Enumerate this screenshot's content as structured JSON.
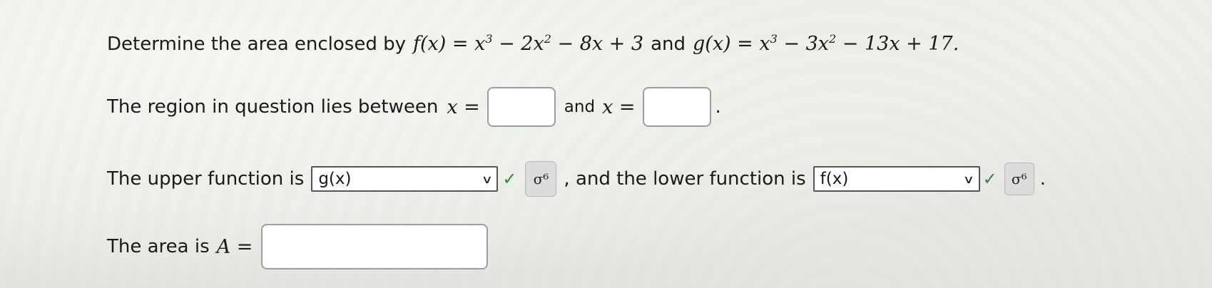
{
  "problem": {
    "prefix": "Determine the area enclosed by",
    "f_def": "f(x) = x",
    "f_exp1": "3",
    "f_mid": " − 2x",
    "f_exp2": "2",
    "f_tail": " − 8x + 3",
    "and_word": "and",
    "g_def": "g(x) = x",
    "g_exp1": "3",
    "g_mid": " − 3x",
    "g_exp2": "2",
    "g_tail": " − 13x + 17."
  },
  "bounds": {
    "text": "The region in question lies between",
    "var_eq_1": "x =",
    "and_word": "and",
    "var_eq_2": "x =",
    "lower_value": "",
    "upper_value": "",
    "end": "."
  },
  "functions": {
    "upper_text": "The upper function is",
    "upper_selected": "g(x)",
    "comma_text": ", and the lower function is",
    "lower_selected": "f(x)",
    "end": ".",
    "check_glyph": "✓",
    "hint_glyph": "σ⁶",
    "chevron_glyph": "∨"
  },
  "area": {
    "text": "The area is",
    "var_eq": "A =",
    "value": ""
  },
  "icons": {
    "check": "checkmark-icon",
    "chevron": "chevron-down-icon",
    "hint": "sigma-hint-icon"
  },
  "colors": {
    "check": "#2f8a3a",
    "input_border": "#9aa0a4",
    "select_border": "#555555",
    "hint_bg": "#dcdcdc"
  }
}
